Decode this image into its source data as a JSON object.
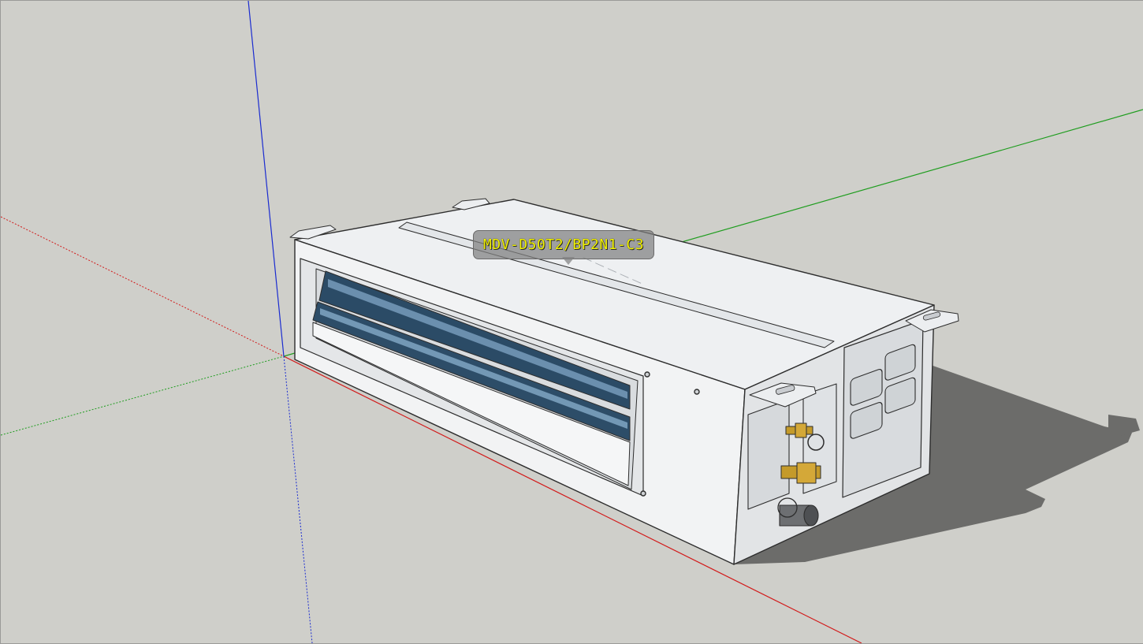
{
  "model_tag": {
    "text": "MDV-D50T2/BP2N1-C3"
  },
  "colors": {
    "background": "#cfcfca",
    "axis_red": "#d21a1a",
    "axis_green": "#1f9d1f",
    "axis_blue": "#1a2bd0",
    "unit_body": "#f0f1f2",
    "shadow": "#6c6c6a",
    "louver": "#2b4b66",
    "brass": "#c49a2a",
    "tag_text": "#f2f200"
  }
}
